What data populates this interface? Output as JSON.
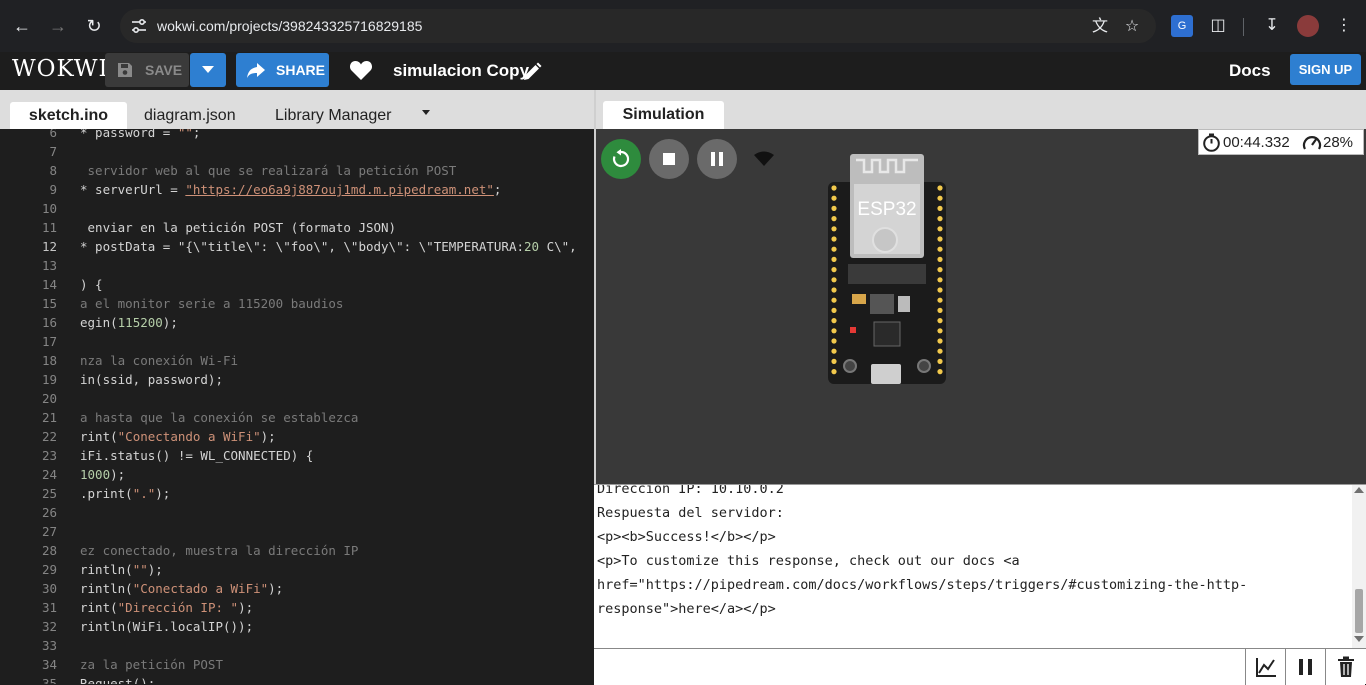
{
  "browser": {
    "url": "wokwi.com/projects/398243325716829185"
  },
  "header": {
    "logo": "WOKWI",
    "save_label": "SAVE",
    "share_label": "SHARE",
    "project_title": "simulacion Copy",
    "docs_label": "Docs",
    "signup_label": "SIGN UP"
  },
  "editor": {
    "tabs": [
      "sketch.ino",
      "diagram.json",
      "Library Manager"
    ],
    "active_tab": "sketch.ino",
    "current_line": 12,
    "lines": [
      {
        "n": "6",
        "text": "* password = \"\";"
      },
      {
        "n": "7",
        "text": ""
      },
      {
        "n": "8",
        "text": " servidor web al que se realizará la petición POST"
      },
      {
        "n": "9",
        "text": "* serverUrl = \"https://eo6a9j887ouj1md.m.pipedream.net\";"
      },
      {
        "n": "10",
        "text": ""
      },
      {
        "n": "11",
        "text": " enviar en la petición POST (formato JSON)"
      },
      {
        "n": "12",
        "text": "* postData = \"{\\\"title\\\": \\\"foo\\\", \\\"body\\\": \\\"TEMPERATURA:20 C\\\","
      },
      {
        "n": "13",
        "text": ""
      },
      {
        "n": "14",
        "text": ") {"
      },
      {
        "n": "15",
        "text": "a el monitor serie a 115200 baudios"
      },
      {
        "n": "16",
        "text": "egin(115200);"
      },
      {
        "n": "17",
        "text": ""
      },
      {
        "n": "18",
        "text": "nza la conexión Wi-Fi"
      },
      {
        "n": "19",
        "text": "in(ssid, password);"
      },
      {
        "n": "20",
        "text": ""
      },
      {
        "n": "21",
        "text": "a hasta que la conexión se establezca"
      },
      {
        "n": "22",
        "text": "rint(\"Conectando a WiFi\");"
      },
      {
        "n": "23",
        "text": "iFi.status() != WL_CONNECTED) {"
      },
      {
        "n": "24",
        "text": "1000);"
      },
      {
        "n": "25",
        "text": ".print(\".\");"
      },
      {
        "n": "26",
        "text": ""
      },
      {
        "n": "27",
        "text": ""
      },
      {
        "n": "28",
        "text": "ez conectado, muestra la dirección IP"
      },
      {
        "n": "29",
        "text": "rintln(\"\");"
      },
      {
        "n": "30",
        "text": "rintln(\"Conectado a WiFi\");"
      },
      {
        "n": "31",
        "text": "rint(\"Dirección IP: \");"
      },
      {
        "n": "32",
        "text": "rintln(WiFi.localIP());"
      },
      {
        "n": "33",
        "text": ""
      },
      {
        "n": "34",
        "text": "za la petición POST"
      },
      {
        "n": "35",
        "text": "Request();"
      }
    ]
  },
  "simulation": {
    "tab_label": "Simulation",
    "elapsed_time": "00:44.332",
    "cpu_usage": "28%",
    "board_label": "ESP32"
  },
  "serial_monitor": {
    "lines": [
      "Direccion IP: 10.10.0.2",
      "Respuesta del servidor:",
      "<p><b>Success!</b></p>",
      "<p>To customize this response, check out our docs <a",
      "href=\"https://pipedream.com/docs/workflows/steps/triggers/#customizing-the-http-",
      "response\">here</a></p>"
    ],
    "input_value": ""
  },
  "colors": {
    "accent": "#2e7fd1",
    "run_green": "#2e8b3d",
    "editor_bg": "#1e1e1e"
  }
}
